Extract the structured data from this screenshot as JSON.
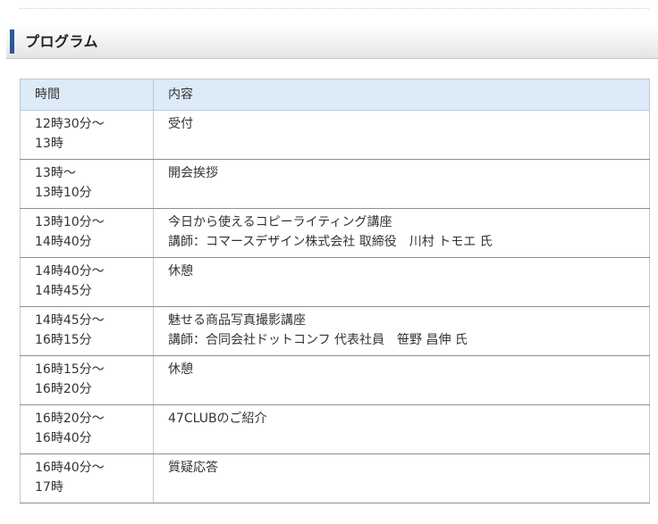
{
  "section": {
    "title": "プログラム"
  },
  "table": {
    "headers": [
      "時間",
      "内容"
    ],
    "rows": [
      {
        "time": [
          "12時30分～",
          "13時"
        ],
        "content": [
          "受付"
        ]
      },
      {
        "time": [
          "13時～",
          "13時10分"
        ],
        "content": [
          "開会挨拶"
        ]
      },
      {
        "time": [
          "13時10分～",
          "14時40分"
        ],
        "content": [
          "今日から使えるコピーライティング講座",
          "講師：コマースデザイン株式会社 取締役　川村 トモエ 氏"
        ]
      },
      {
        "time": [
          "14時40分～",
          "14時45分"
        ],
        "content": [
          "休憩"
        ]
      },
      {
        "time": [
          "14時45分～",
          "16時15分"
        ],
        "content": [
          "魅せる商品写真撮影講座",
          "講師：合同会社ドットコンフ 代表社員　笹野 昌伸 氏"
        ]
      },
      {
        "time": [
          "16時15分～",
          "16時20分"
        ],
        "content": [
          "休憩"
        ]
      },
      {
        "time": [
          "16時20分～",
          "16時40分"
        ],
        "content": [
          "47CLUBのご紹介"
        ]
      },
      {
        "time": [
          "16時40分～",
          "17時"
        ],
        "content": [
          "質疑応答"
        ]
      }
    ]
  },
  "colors": {
    "accent": "#2d5a94",
    "header_bg": "#dcebf7"
  }
}
